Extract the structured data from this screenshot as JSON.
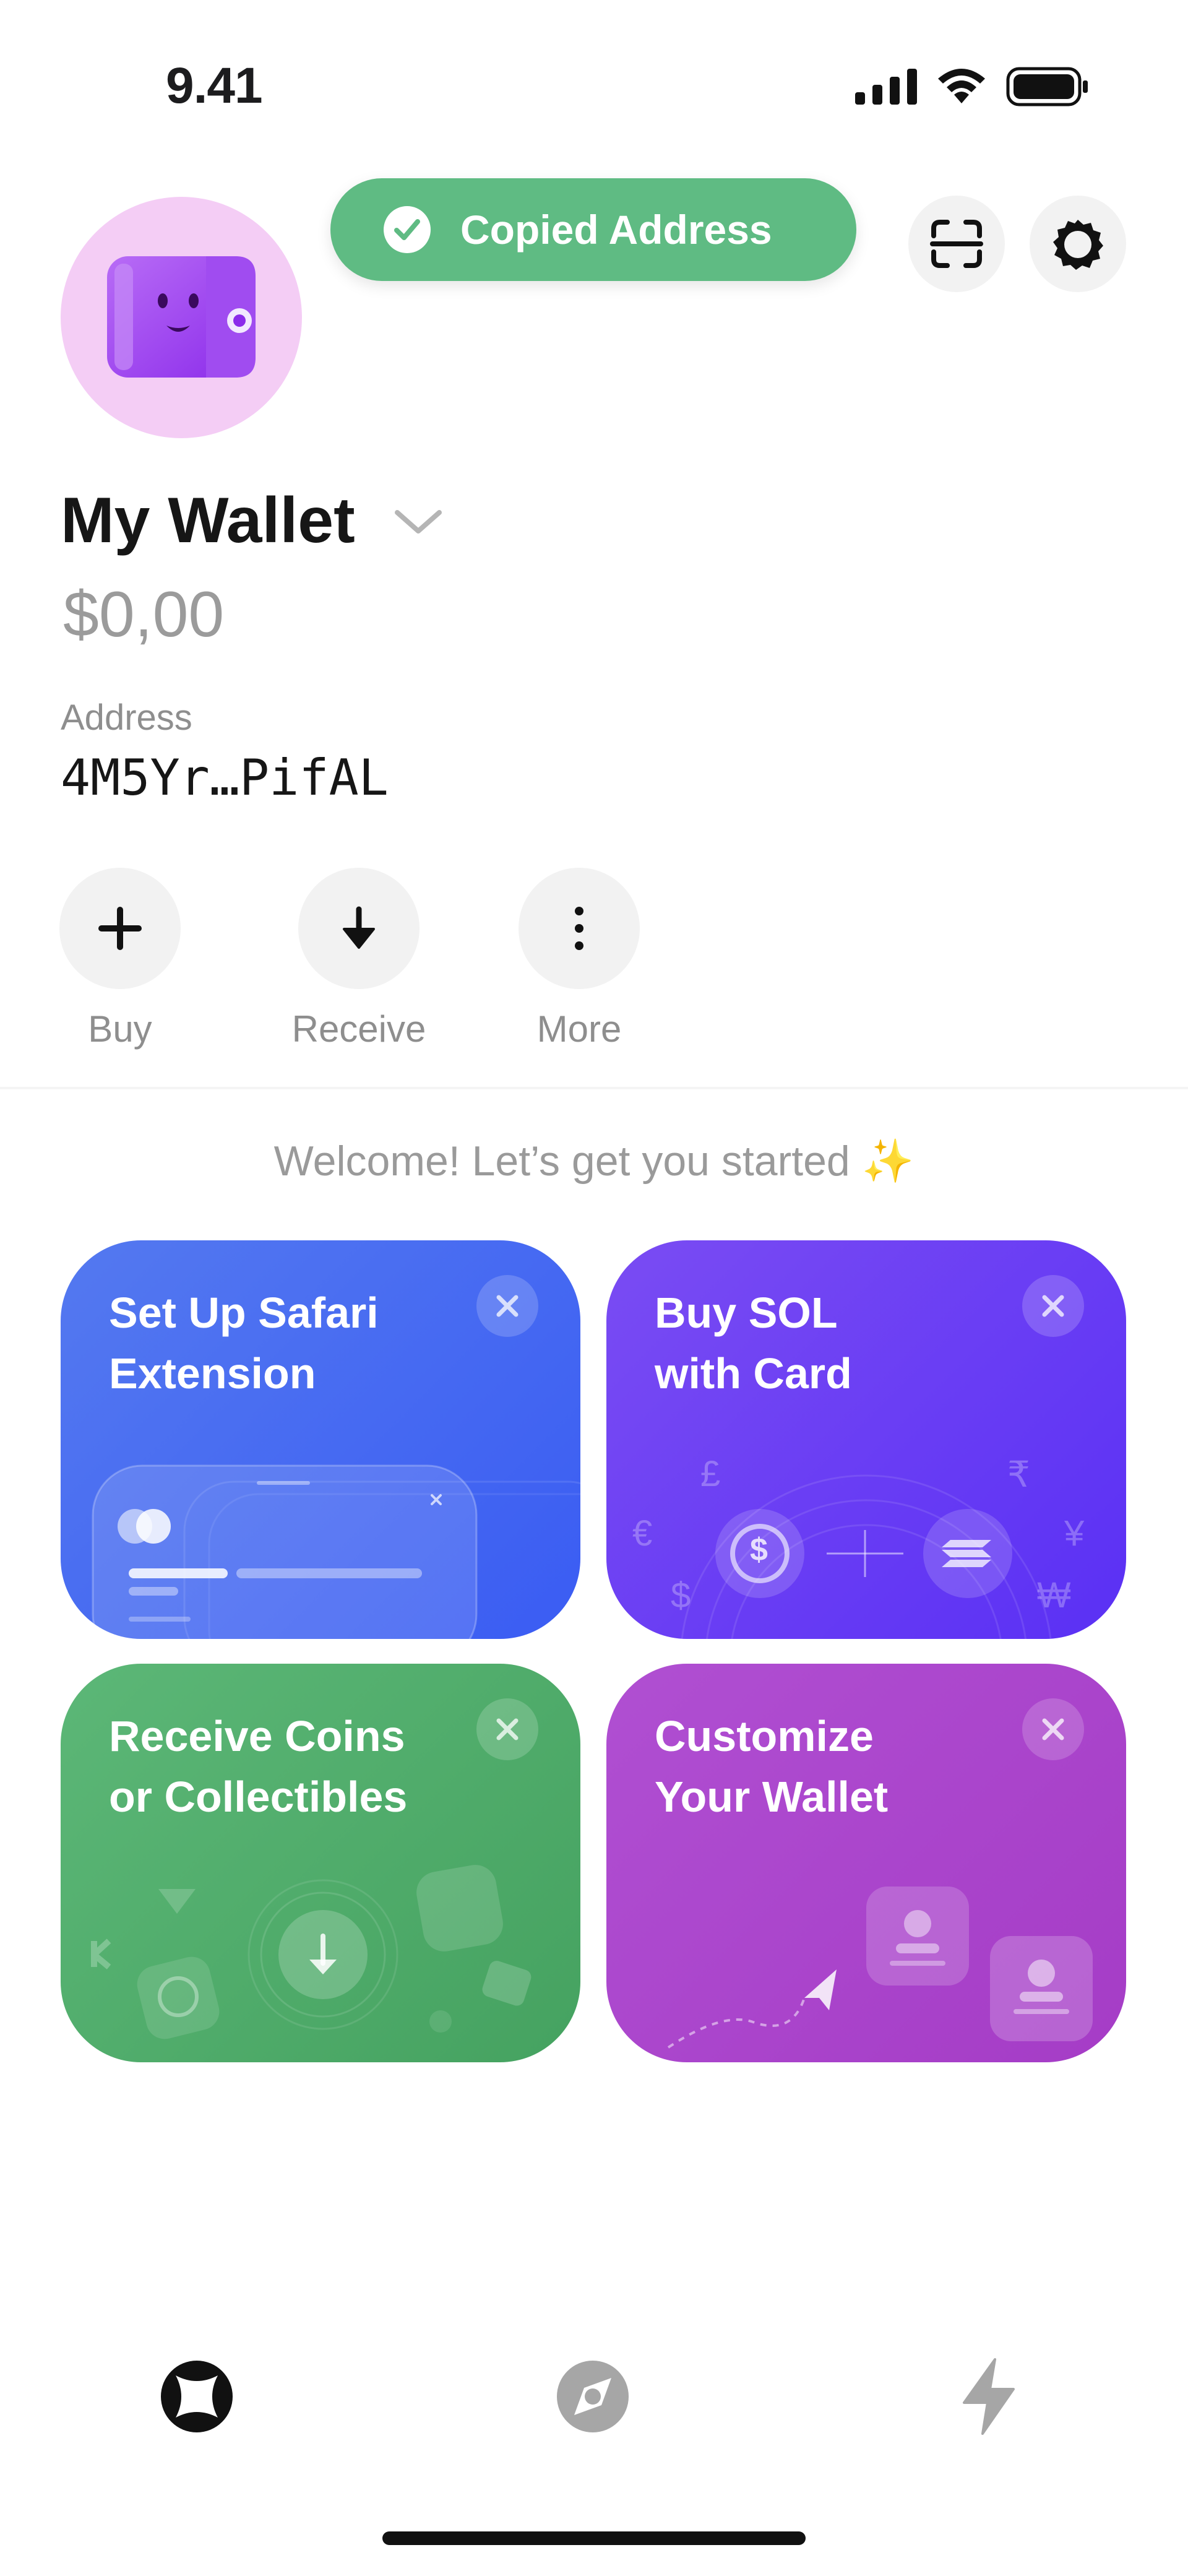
{
  "status_bar": {
    "time": "9.41",
    "signal_icon": "signal-bars-icon",
    "wifi_icon": "wifi-icon",
    "battery_icon": "battery-icon"
  },
  "toast": {
    "text": "Copied Address",
    "icon": "checkmark-circle-icon",
    "color": "#5fbb83"
  },
  "header": {
    "scan_button_icon": "qr-scan-icon",
    "settings_button_icon": "gear-icon",
    "avatar_icon": "wallet-avatar-icon"
  },
  "wallet": {
    "name": "My Wallet",
    "balance": "$0,00",
    "address_label": "Address",
    "address": "4M5Yr…PifAL"
  },
  "actions": [
    {
      "label": "Buy",
      "icon": "plus-icon"
    },
    {
      "label": "Receive",
      "icon": "arrow-down-icon"
    },
    {
      "label": "More",
      "icon": "more-vertical-icon"
    }
  ],
  "welcome": {
    "text": "Welcome! Let’s get you started ✨"
  },
  "cards": [
    {
      "title_line1": "Set Up Safari",
      "title_line2": "Extension",
      "color": "#4a6cf2"
    },
    {
      "title_line1": "Buy SOL",
      "title_line2": "with Card",
      "color": "#6a3ff4",
      "currency_symbols": [
        "£",
        "₹",
        "€",
        "¥",
        "$",
        "₩"
      ]
    },
    {
      "title_line1": "Receive Coins",
      "title_line2": "or Collectibles",
      "color": "#51ad6c"
    },
    {
      "title_line1": "Customize",
      "title_line2": "Your Wallet",
      "color": "#ab46cc"
    }
  ],
  "tab_bar": {
    "tabs": [
      {
        "icon": "home-wallet-icon",
        "active": true
      },
      {
        "icon": "explore-compass-icon",
        "active": false
      },
      {
        "icon": "activity-lightning-icon",
        "active": false
      }
    ]
  }
}
